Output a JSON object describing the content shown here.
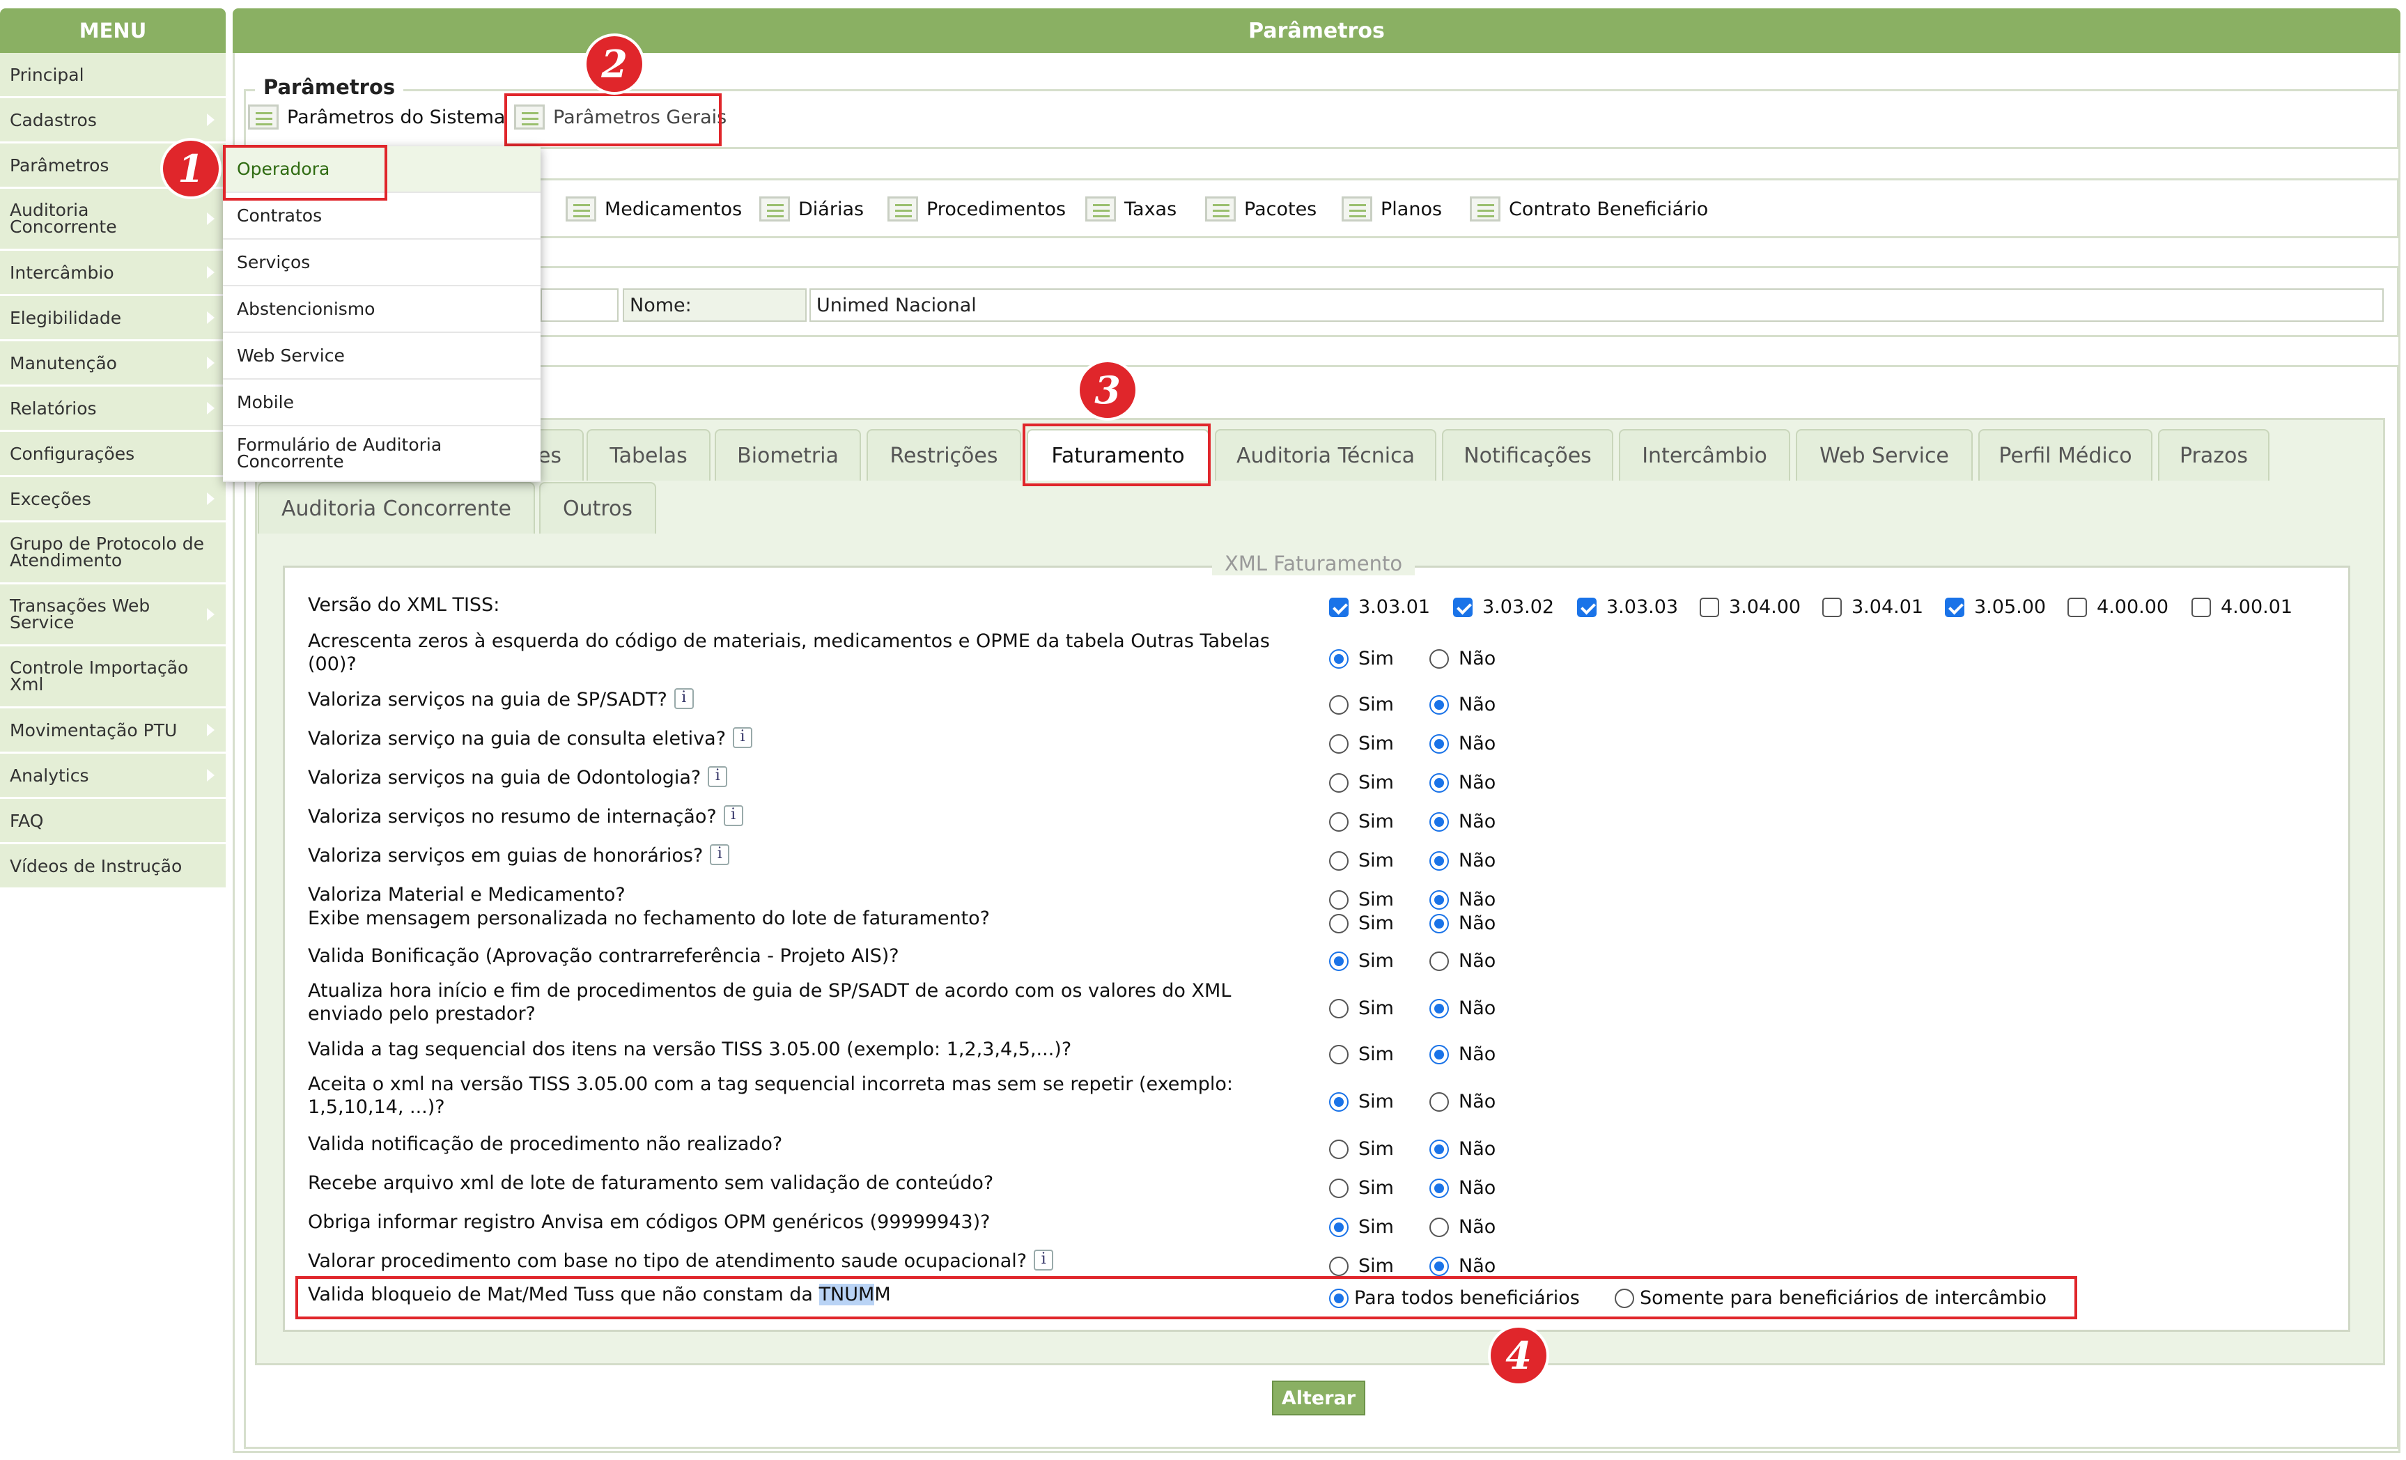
{
  "menu": {
    "title": "MENU",
    "items": [
      {
        "label": "Principal"
      },
      {
        "label": "Cadastros"
      },
      {
        "label": "Parâmetros"
      },
      {
        "label": "Auditoria Concorrente"
      },
      {
        "label": "Intercâmbio"
      },
      {
        "label": "Elegibilidade"
      },
      {
        "label": "Manutenção"
      },
      {
        "label": "Relatórios"
      },
      {
        "label": "Configurações"
      },
      {
        "label": "Exceções"
      },
      {
        "label": "Grupo de Protocolo de Atendimento"
      },
      {
        "label": "Transações Web Service"
      },
      {
        "label": "Controle Importação Xml"
      },
      {
        "label": "Movimentação PTU"
      },
      {
        "label": "Analytics"
      },
      {
        "label": "FAQ"
      },
      {
        "label": "Vídeos de Instrução"
      }
    ]
  },
  "submenu": {
    "items": [
      "Operadora",
      "Contratos",
      "Serviços",
      "Abstencionismo",
      "Web Service",
      "Mobile",
      "Formulário de Auditoria Concorrente"
    ]
  },
  "header": {
    "title": "Parâmetros"
  },
  "parametros": {
    "legend": "Parâmetros",
    "links": [
      "Parâmetros do Sistema",
      "Parâmetros Gerais"
    ]
  },
  "subparams": {
    "links": [
      "Medicamentos",
      "Diárias",
      "Procedimentos",
      "Taxas",
      "Pacotes",
      "Planos",
      "Contrato Beneficiário"
    ]
  },
  "operator": {
    "nome_label": "Nome:",
    "nome_value": "Unimed Nacional"
  },
  "tabs": {
    "row1": [
      "es",
      "Tabelas",
      "Biometria",
      "Restrições",
      "Faturamento",
      "Auditoria Técnica",
      "Notificações",
      "Intercâmbio",
      "Web Service",
      "Perfil Médico",
      "Prazos"
    ],
    "row2": [
      "Auditoria Concorrente",
      "Outros"
    ],
    "active": "Faturamento"
  },
  "xml": {
    "legend": "XML Faturamento",
    "version_label": "Versão do XML TISS:",
    "versions": [
      {
        "label": "3.03.01",
        "checked": true
      },
      {
        "label": "3.03.02",
        "checked": true
      },
      {
        "label": "3.03.03",
        "checked": true
      },
      {
        "label": "3.04.00",
        "checked": false
      },
      {
        "label": "3.04.01",
        "checked": false
      },
      {
        "label": "3.05.00",
        "checked": true
      },
      {
        "label": "4.00.00",
        "checked": false
      },
      {
        "label": "4.00.01",
        "checked": false
      }
    ],
    "sim": "Sim",
    "nao": "Não",
    "questions": [
      {
        "text": "Acrescenta zeros à esquerda do código de materiais, medicamentos e OPME da tabela Outras Tabelas (00)?",
        "value": "Sim"
      },
      {
        "text": "Valoriza serviços na guia de SP/SADT?",
        "value": "Não",
        "info": true
      },
      {
        "text": "Valoriza serviço na guia de consulta eletiva?",
        "value": "Não",
        "info": true
      },
      {
        "text": "Valoriza serviços na guia de Odontologia?",
        "value": "Não",
        "info": true
      },
      {
        "text": "Valoriza serviços no resumo de internação?",
        "value": "Não",
        "info": true
      },
      {
        "text": "Valoriza serviços em guias de honorários?",
        "value": "Não",
        "info": true
      },
      {
        "text": "Valoriza Material e Medicamento?",
        "value": "Não"
      },
      {
        "text": "Exibe mensagem personalizada no fechamento do lote de faturamento?",
        "value": "Não"
      },
      {
        "text": "Valida Bonificação (Aprovação contrarreferência - Projeto AIS)?",
        "value": "Sim"
      },
      {
        "text": "Atualiza hora início e fim de procedimentos de guia de SP/SADT de acordo com os valores do XML enviado pelo prestador?",
        "value": "Não"
      },
      {
        "text": "Valida a tag sequencial dos itens na versão TISS 3.05.00 (exemplo: 1,2,3,4,5,...)?",
        "value": "Não"
      },
      {
        "text": "Aceita o xml na versão TISS 3.05.00 com a tag sequencial incorreta mas sem se repetir (exemplo: 1,5,10,14, ...)?",
        "value": "Sim"
      },
      {
        "text": "Valida notificação de procedimento não realizado?",
        "value": "Não"
      },
      {
        "text": "Recebe arquivo xml de lote de faturamento sem validação de conteúdo?",
        "value": "Não"
      },
      {
        "text": "Obriga informar registro Anvisa em códigos OPM genéricos (99999943)?",
        "value": "Sim"
      },
      {
        "text": "Valorar procedimento com base no tipo de atendimento saude ocupacional?",
        "value": "Não",
        "info": true
      }
    ],
    "tnumm": {
      "text_before": "Valida bloqueio de Mat/Med Tuss que não constam da ",
      "text_highlight": "TNUM",
      "text_after": "M",
      "opt_all": "Para todos beneficiários",
      "opt_inter": "Somente para beneficiários de intercâmbio",
      "value": "all"
    }
  },
  "badges": [
    "1",
    "2",
    "3",
    "4"
  ],
  "buttons": {
    "alterar": "Alterar"
  },
  "colors": {
    "brand_green": "#8ab063",
    "annotation_red": "#e0262b",
    "radio_blue": "#1a73e8"
  }
}
